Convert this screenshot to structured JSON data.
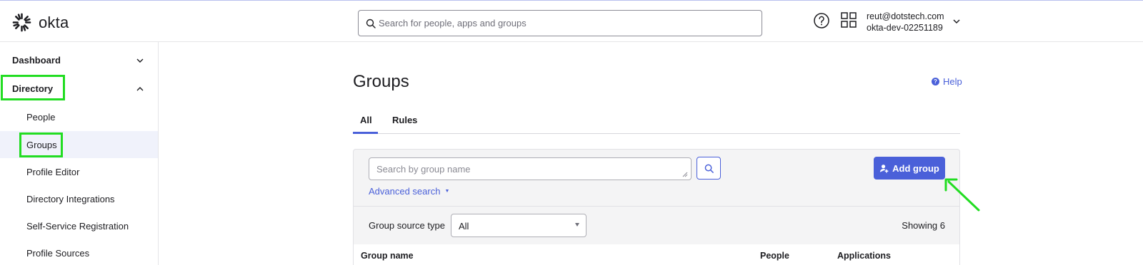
{
  "header": {
    "logo_text": "okta",
    "search_placeholder": "Search for people, apps and groups",
    "user_email": "reut@dotstech.com",
    "user_org": "okta-dev-02251189"
  },
  "sidebar": {
    "dashboard": "Dashboard",
    "directory": "Directory",
    "items": [
      {
        "label": "People"
      },
      {
        "label": "Groups"
      },
      {
        "label": "Profile Editor"
      },
      {
        "label": "Directory Integrations"
      },
      {
        "label": "Self-Service Registration"
      },
      {
        "label": "Profile Sources"
      }
    ]
  },
  "main": {
    "title": "Groups",
    "help_label": "Help",
    "tabs": [
      {
        "label": "All"
      },
      {
        "label": "Rules"
      }
    ],
    "group_search_placeholder": "Search by group name",
    "advanced_search": "Advanced search",
    "add_group": "Add group",
    "filter_label": "Group source type",
    "filter_value": "All",
    "showing": "Showing 6",
    "columns": [
      "Group name",
      "People",
      "Applications"
    ]
  },
  "colors": {
    "accent": "#4a60d9",
    "highlight": "#22dd22"
  }
}
